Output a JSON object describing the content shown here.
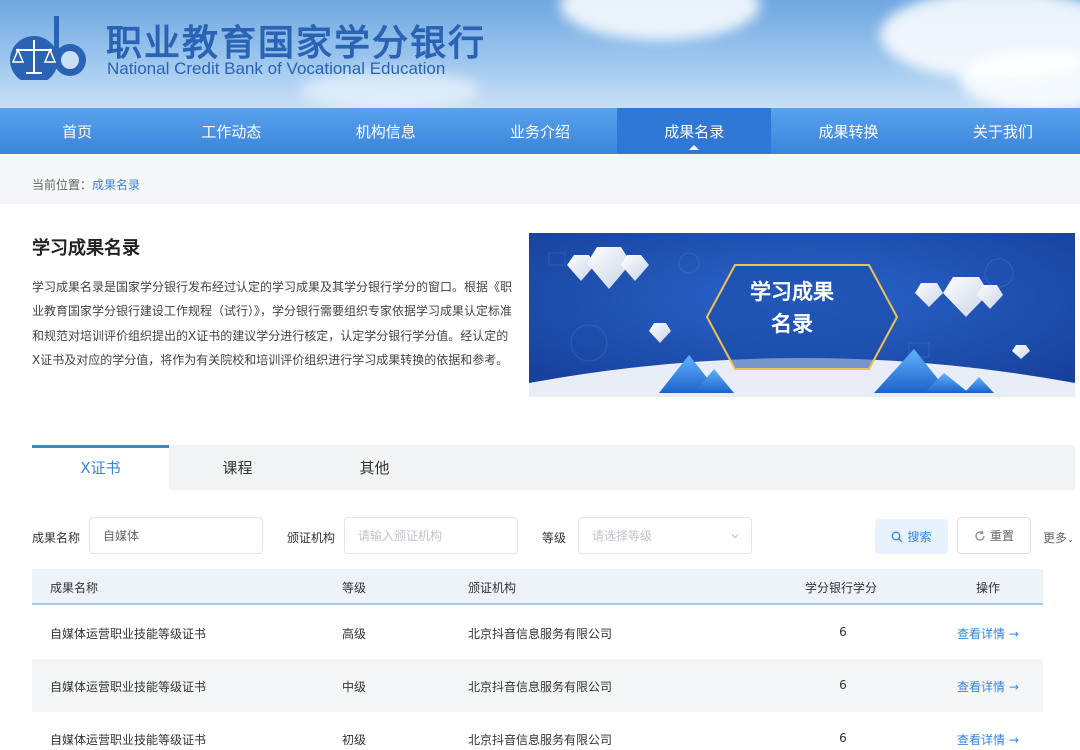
{
  "header": {
    "title": "职业教育国家学分银行",
    "subtitle": "National Credit Bank of Vocational Education"
  },
  "nav": {
    "items": [
      {
        "label": "首页"
      },
      {
        "label": "工作动态"
      },
      {
        "label": "机构信息"
      },
      {
        "label": "业务介绍"
      },
      {
        "label": "成果名录"
      },
      {
        "label": "成果转换"
      },
      {
        "label": "关于我们"
      }
    ],
    "active_index": 4
  },
  "breadcrumb": {
    "prefix": "当前位置：",
    "current": "成果名录"
  },
  "intro": {
    "title": "学习成果名录",
    "text": "学习成果名录是国家学分银行发布经过认定的学习成果及其学分银行学分的窗口。根据《职业教育国家学分银行建设工作规程（试行）》，学分银行需要组织专家依据学习成果认定标准和规范对培训评价组织提出的X证书的建议学分进行核定，认定学分银行学分值。经认定的X证书及对应的学分值，将作为有关院校和培训评价组织进行学习成果转换的依据和参考。"
  },
  "banner": {
    "line1": "学习成果",
    "line2": "名录"
  },
  "tabs": [
    {
      "label": "X证书"
    },
    {
      "label": "课程"
    },
    {
      "label": "其他"
    }
  ],
  "filter": {
    "name_label": "成果名称",
    "name_value": "自媒体",
    "issuer_label": "颁证机构",
    "issuer_placeholder": "请输入颁证机构",
    "level_label": "等级",
    "level_placeholder": "请选择等级",
    "search_label": "搜索",
    "reset_label": "重置",
    "more_label": "更多"
  },
  "table": {
    "columns": [
      "成果名称",
      "等级",
      "颁证机构",
      "学分银行学分",
      "操作"
    ],
    "rows": [
      {
        "name": "自媒体运营职业技能等级证书",
        "level": "高级",
        "issuer": "北京抖音信息服务有限公司",
        "credit": "6",
        "action": "查看详情 →"
      },
      {
        "name": "自媒体运营职业技能等级证书",
        "level": "中级",
        "issuer": "北京抖音信息服务有限公司",
        "credit": "6",
        "action": "查看详情 →"
      },
      {
        "name": "自媒体运营职业技能等级证书",
        "level": "初级",
        "issuer": "北京抖音信息服务有限公司",
        "credit": "6",
        "action": "查看详情 →"
      }
    ]
  },
  "colors": {
    "brand": "#2a63b3",
    "accent": "#3a84dc",
    "nav_active": "#2f78d6",
    "banner_bg": "#1f4fb0",
    "banner_gold": "#f2c14e"
  }
}
